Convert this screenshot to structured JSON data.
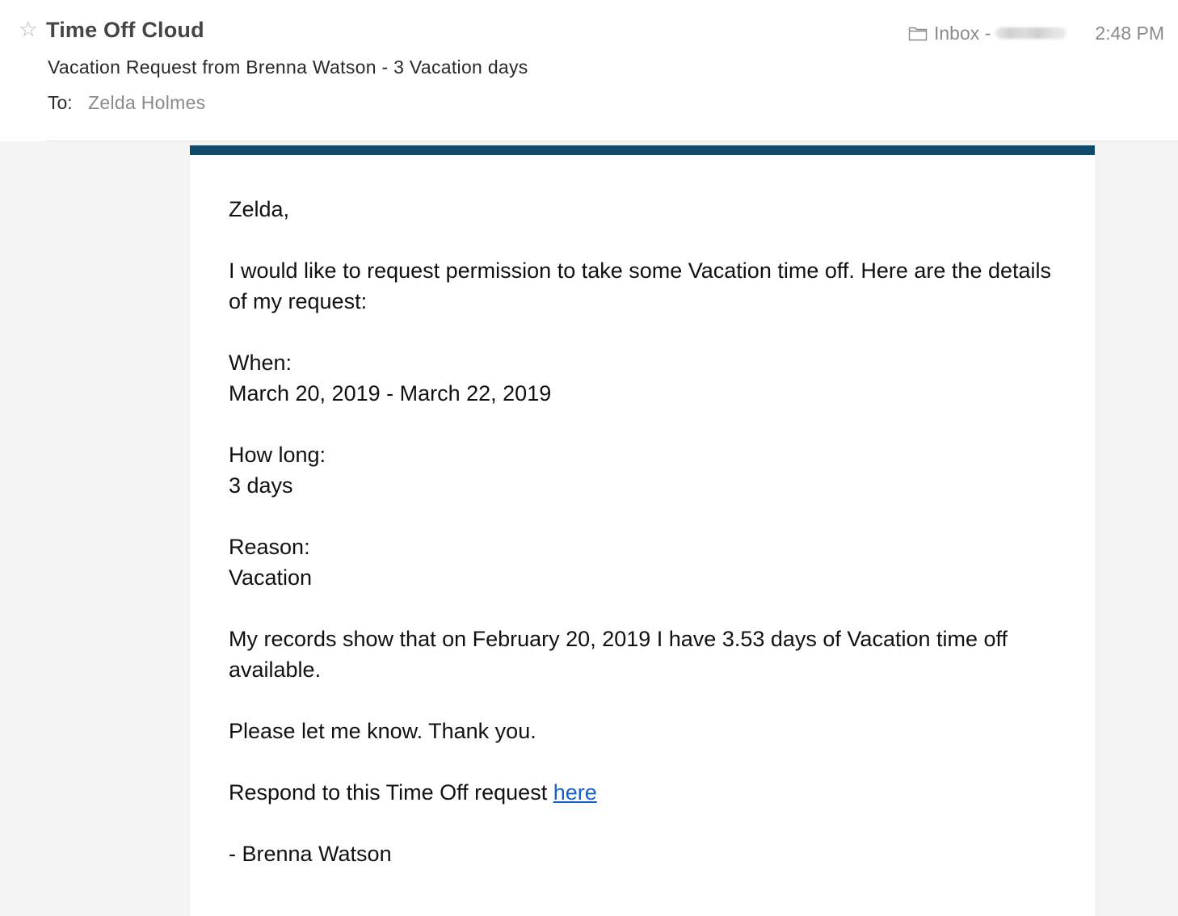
{
  "header": {
    "star_glyph": "☆",
    "sender": "Time Off Cloud",
    "subject": "Vacation Request from Brenna Watson - 3 Vacation days",
    "to_label": "To:",
    "to_value": "Zelda Holmes",
    "mailbox": "Inbox -",
    "time": "2:48 PM"
  },
  "message": {
    "greeting": "Zelda,",
    "intro": "I would like to request permission to take some Vacation time off. Here are the details of my request:",
    "when_label": "When:",
    "when_value": "March 20, 2019 - March 22, 2019",
    "how_long_label": "How long:",
    "how_long_value": "3 days",
    "reason_label": "Reason:",
    "reason_value": "Vacation",
    "records": "My records show that on February 20, 2019 I have 3.53 days of Vacation time off available.",
    "closing": "Please let me know. Thank you.",
    "respond_prefix": "Respond to this Time Off request ",
    "respond_link": "here",
    "signature": "- Brenna Watson"
  },
  "colors": {
    "accent_bar": "#0f4a6b",
    "link": "#1a5fd0"
  },
  "icons": {
    "star": "star-icon",
    "folder": "folder-icon"
  }
}
